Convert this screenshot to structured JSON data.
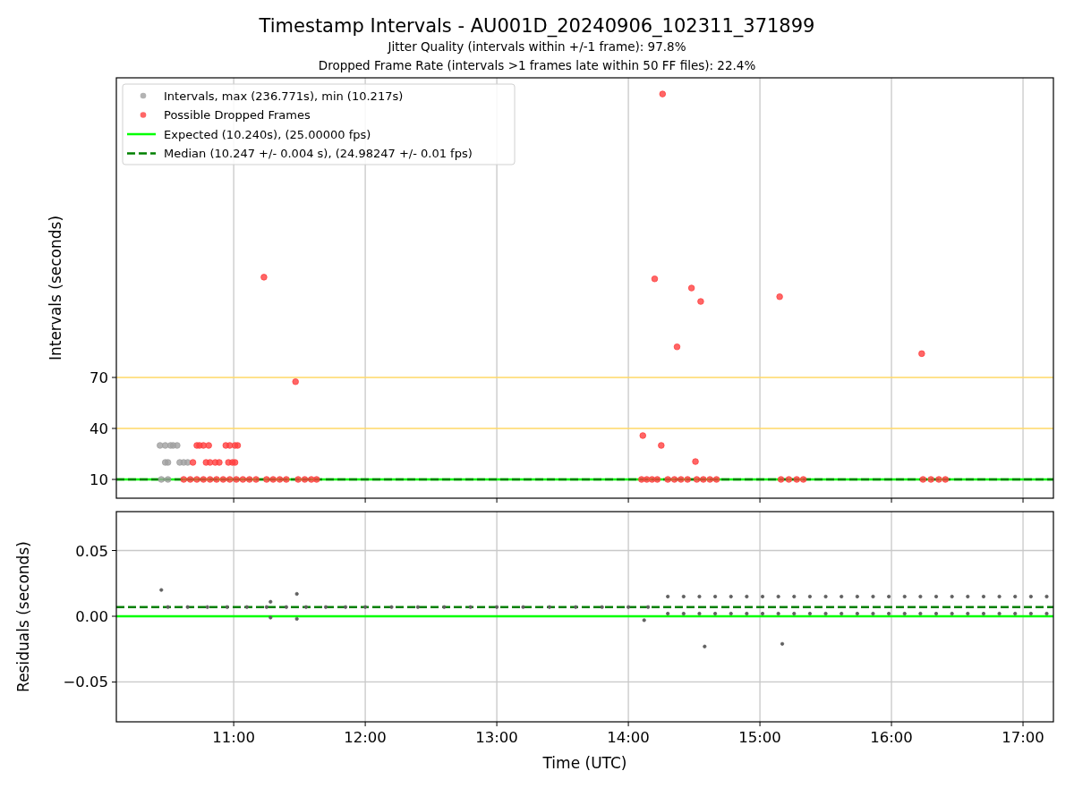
{
  "figure": {
    "title": "Timestamp Intervals - AU001D_20240906_102311_371899",
    "subtitles": [
      "Jitter Quality (intervals within +/-1 frame): 97.8%",
      "Dropped Frame Rate (intervals >1 frames late within 50 FF files): 22.4%"
    ]
  },
  "intervals_plot": {
    "chart_data": {
      "type": "scatter",
      "ylabel": "Intervals (seconds)",
      "xlim": [
        10.108,
        17.231
      ],
      "ylim": [
        -1.05,
        246.3
      ],
      "grid": "x",
      "legend": "upper left",
      "yticks": [
        {
          "value": 10,
          "label": "10"
        },
        {
          "value": 40,
          "label": "40"
        },
        {
          "value": 70,
          "label": "70"
        }
      ],
      "ref_lines": [
        {
          "axis": "y",
          "value": 40,
          "color": "#ffd966"
        },
        {
          "axis": "y",
          "value": 70,
          "color": "#ffd966"
        }
      ],
      "series": [
        {
          "name": "Intervals, max (236.771s), min (10.217s)",
          "type": "scatter",
          "color": "#a0a0a0",
          "x": [
            10.44,
            10.48,
            10.52,
            10.54,
            10.57,
            10.48,
            10.5,
            10.59,
            10.62,
            10.65,
            10.45,
            10.5
          ],
          "values": [
            30,
            30,
            30,
            30,
            30,
            20,
            20,
            20,
            20,
            20,
            10,
            10
          ]
        },
        {
          "name": "Possible Dropped Frames",
          "type": "scatter",
          "color": "#ff4040",
          "x": [
            10.72,
            10.74,
            10.77,
            10.81,
            10.94,
            10.97,
            11.01,
            11.03,
            10.69,
            10.79,
            10.82,
            10.86,
            10.89,
            10.96,
            10.99,
            11.01,
            10.62,
            10.67,
            10.72,
            10.77,
            10.82,
            10.87,
            10.92,
            10.97,
            11.02,
            11.07,
            11.12,
            11.17,
            11.25,
            11.3,
            11.35,
            11.4,
            11.49,
            11.54,
            11.59,
            11.63,
            14.1,
            14.14,
            14.18,
            14.22,
            14.3,
            14.35,
            14.4,
            14.45,
            14.52,
            14.57,
            14.62,
            14.67,
            15.16,
            15.22,
            15.28,
            15.33,
            16.24,
            16.3,
            16.36,
            16.41,
            11.23,
            11.47,
            14.26,
            14.2,
            14.48,
            14.55,
            14.37,
            15.15,
            16.23,
            14.11,
            14.25,
            14.51
          ],
          "values": [
            30,
            30,
            30,
            30,
            30,
            30,
            30,
            30,
            20,
            20,
            20,
            20,
            20,
            20,
            20,
            20,
            10,
            10,
            10,
            10,
            10,
            10,
            10,
            10,
            10,
            10,
            10,
            10,
            10,
            10,
            10,
            10,
            10,
            10,
            10,
            10,
            10,
            10,
            10,
            10,
            10,
            10,
            10,
            10,
            10,
            10,
            10,
            10,
            10,
            10,
            10,
            10,
            10,
            10,
            10,
            10,
            129,
            67.5,
            236.771,
            128,
            122.6,
            114.7,
            88,
            117.5,
            84,
            35.8,
            30,
            20.5
          ]
        },
        {
          "name": "Expected (10.240s), (25.00000 fps)",
          "type": "line",
          "color": "#00ff00",
          "line_style": "solid",
          "x": [
            10.108,
            17.231
          ],
          "values": [
            10,
            10
          ]
        },
        {
          "name": "Median (10.247 +/- 0.004 s), (24.98247 +/- 0.01 fps)",
          "type": "line",
          "color": "#008000",
          "line_style": "dashed",
          "x": [
            10.108,
            17.231
          ],
          "values": [
            10,
            10
          ]
        }
      ]
    }
  },
  "residuals_plot": {
    "chart_data": {
      "type": "scatter",
      "xlabel": "Time (UTC)",
      "ylabel": "Residuals (seconds)",
      "xlim": [
        10.108,
        17.231
      ],
      "ylim": [
        -0.0803,
        0.0796
      ],
      "grid": "both",
      "xticks": [
        {
          "value": 11,
          "label": "11:00"
        },
        {
          "value": 12,
          "label": "12:00"
        },
        {
          "value": 13,
          "label": "13:00"
        },
        {
          "value": 14,
          "label": "14:00"
        },
        {
          "value": 15,
          "label": "15:00"
        },
        {
          "value": 16,
          "label": "16:00"
        },
        {
          "value": 17,
          "label": "17:00"
        }
      ],
      "yticks": [
        {
          "value": 0.05,
          "label": "0.05"
        },
        {
          "value": 0,
          "label": "0.00"
        },
        {
          "value": -0.05,
          "label": "−0.05"
        }
      ],
      "series": [
        {
          "type": "scatter",
          "color": "#606060",
          "x": [
            10.5,
            10.65,
            10.8,
            10.95,
            11.1,
            11.25,
            11.4,
            11.55,
            11.7,
            11.85,
            12.0,
            12.2,
            12.4,
            12.6,
            12.8,
            13.0,
            13.2,
            13.4,
            13.6,
            13.8,
            14.0,
            14.15,
            10.45,
            11.28,
            11.28,
            11.48,
            11.48,
            14.12,
            14.58,
            15.17,
            14.3,
            14.3,
            14.42,
            14.42,
            14.54,
            14.54,
            14.66,
            14.66,
            14.78,
            14.78,
            14.9,
            14.9,
            15.02,
            15.02,
            15.14,
            15.14,
            15.26,
            15.26,
            15.38,
            15.38,
            15.5,
            15.5,
            15.62,
            15.62,
            15.74,
            15.74,
            15.86,
            15.86,
            15.98,
            15.98,
            16.1,
            16.1,
            16.22,
            16.22,
            16.34,
            16.34,
            16.46,
            16.46,
            16.58,
            16.58,
            16.7,
            16.7,
            16.82,
            16.82,
            16.94,
            16.94,
            17.06,
            17.06,
            17.18,
            17.18
          ],
          "values": [
            0.007,
            0.007,
            0.007,
            0.007,
            0.007,
            0.007,
            0.007,
            0.007,
            0.007,
            0.007,
            0.007,
            0.007,
            0.007,
            0.007,
            0.007,
            0.007,
            0.007,
            0.007,
            0.007,
            0.007,
            0.007,
            0.007,
            0.02,
            0.011,
            -0.001,
            0.017,
            -0.002,
            -0.003,
            -0.023,
            -0.021,
            0.015,
            0.002,
            0.015,
            0.002,
            0.015,
            0.002,
            0.015,
            0.002,
            0.015,
            0.002,
            0.015,
            0.002,
            0.015,
            0.002,
            0.015,
            0.002,
            0.015,
            0.002,
            0.015,
            0.002,
            0.015,
            0.002,
            0.015,
            0.002,
            0.015,
            0.002,
            0.015,
            0.002,
            0.015,
            0.002,
            0.015,
            0.002,
            0.015,
            0.002,
            0.015,
            0.002,
            0.015,
            0.002,
            0.015,
            0.002,
            0.015,
            0.002,
            0.015,
            0.002,
            0.015,
            0.002,
            0.015,
            0.002,
            0.015,
            0.002
          ]
        },
        {
          "type": "line",
          "color": "#00ff00",
          "line_style": "solid",
          "x": [
            10.108,
            17.231
          ],
          "values": [
            0,
            0
          ]
        },
        {
          "type": "line",
          "color": "#008000",
          "line_style": "dashed",
          "x": [
            10.108,
            17.231
          ],
          "values": [
            0.007,
            0.007
          ]
        }
      ]
    }
  }
}
